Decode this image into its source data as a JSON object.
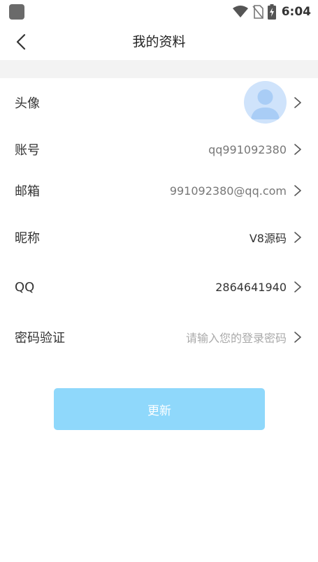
{
  "status_bar": {
    "time": "6:04",
    "icons": [
      "app-icon",
      "wifi-icon",
      "no-sim-icon",
      "battery-charging-icon"
    ]
  },
  "header": {
    "title": "我的资料",
    "back_icon": "chevron-left-icon"
  },
  "rows": {
    "avatar": {
      "label": "头像"
    },
    "account": {
      "label": "账号",
      "value": "qq991092380"
    },
    "email": {
      "label": "邮箱",
      "value": "991092380@qq.com"
    },
    "nickname": {
      "label": "昵称",
      "value": "V8源码"
    },
    "qq": {
      "label": "QQ",
      "value": "2864641940"
    },
    "password": {
      "label": "密码验证",
      "placeholder": "请输入您的登录密码"
    }
  },
  "update_button": {
    "label": "更新"
  },
  "colors": {
    "accent": "#8fd8fb",
    "avatar_bg": "#cfe3fb",
    "avatar_figure": "#a9cdf6",
    "divider_band": "#f3f3f3"
  }
}
